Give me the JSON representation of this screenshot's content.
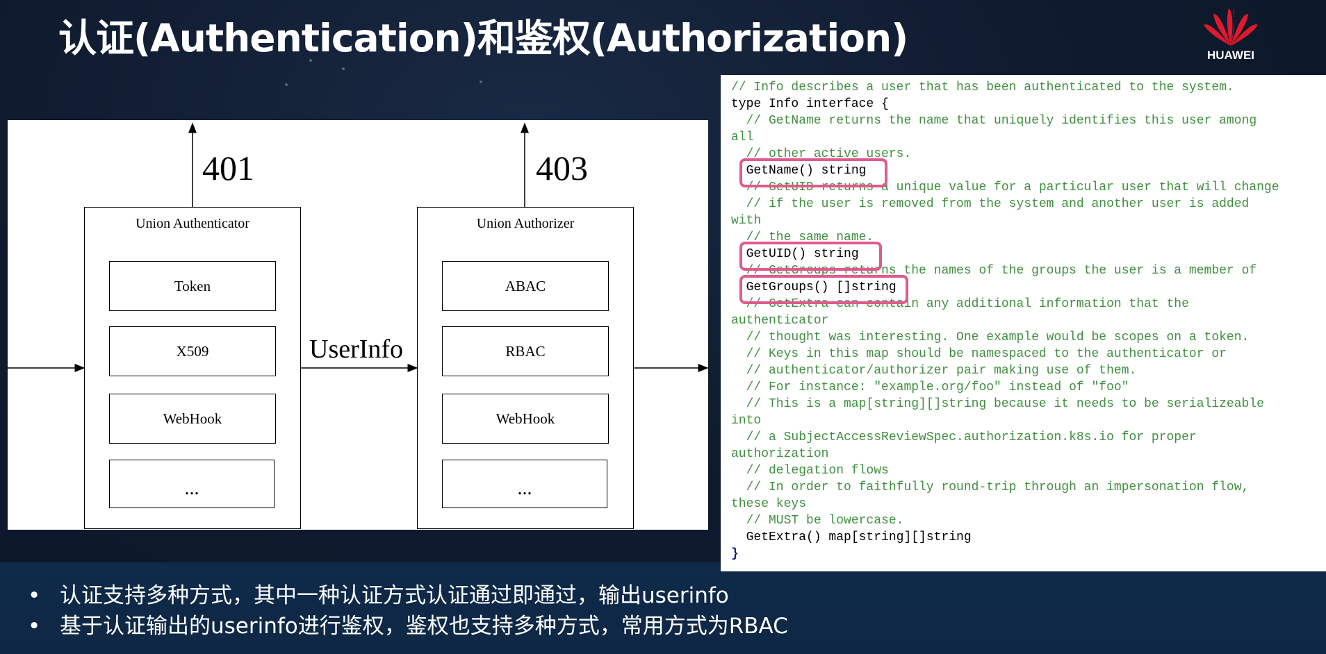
{
  "title": "认证(Authentication)和鉴权(Authorization)",
  "logo": {
    "text": "HUAWEI",
    "icon": "huawei-petal-logo",
    "color": "#e0192c"
  },
  "diagram": {
    "code_401": "401",
    "code_403": "403",
    "userinfo": "UserInfo",
    "authenticator": {
      "title": "Union Authenticator",
      "items": [
        "Token",
        "X509",
        "WebHook",
        "..."
      ]
    },
    "authorizer": {
      "title": "Union Authorizer",
      "items": [
        "ABAC",
        "RBAC",
        "WebHook",
        "..."
      ]
    }
  },
  "code": {
    "highlight_color": "#e05a8d",
    "lines": [
      "// Info describes a user that has been authenticated to the system.",
      "type Info interface {",
      "  // GetName returns the name that uniquely identifies this user among",
      "all",
      "  // other active users.",
      "  GetName() string",
      "  // GetUID returns a unique value for a particular user that will change",
      "  // if the user is removed from the system and another user is added",
      "with",
      "  // the same name.",
      "  GetUID() string",
      "  // GetGroups returns the names of the groups the user is a member of",
      "  GetGroups() []string",
      "  // GetExtra can contain any additional information that the",
      "authenticator",
      "  // thought was interesting. One example would be scopes on a token.",
      "  // Keys in this map should be namespaced to the authenticator or",
      "  // authenticator/authorizer pair making use of them.",
      "  // For instance: \"example.org/foo\" instead of \"foo\"",
      "  // This is a map[string][]string because it needs to be serializeable",
      "into",
      "  // a SubjectAccessReviewSpec.authorization.k8s.io for proper",
      "authorization",
      "  // delegation flows",
      "  // In order to faithfully round-trip through an impersonation flow,",
      "these keys",
      "  // MUST be lowercase.",
      "  GetExtra() map[string][]string",
      "}"
    ]
  },
  "bullets": [
    "认证支持多种方式，其中一种认证方式认证通过即通过，输出userinfo",
    "基于认证输出的userinfo进行鉴权，鉴权也支持多种方式，常用方式为RBAC"
  ]
}
